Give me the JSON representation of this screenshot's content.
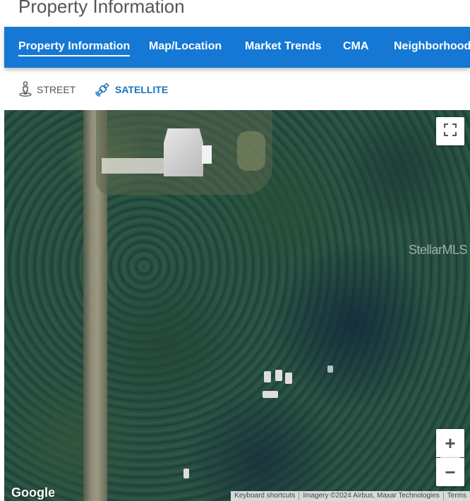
{
  "header": {
    "title": "Property Information"
  },
  "tabs": [
    {
      "label": "Property Information",
      "active": true
    },
    {
      "label": "Map/Location",
      "active": false
    },
    {
      "label": "Market Trends",
      "active": false
    },
    {
      "label": "CMA",
      "active": false
    },
    {
      "label": "Neighborhood",
      "active": false
    }
  ],
  "map_view": {
    "street_label": "STREET",
    "street_icon": "street-view-icon",
    "satellite_label": "SATELLITE",
    "satellite_icon": "satellite-icon",
    "selected": "SATELLITE"
  },
  "map": {
    "watermark": "StellarMLS",
    "logo": "Google",
    "attribution": {
      "shortcuts": "Keyboard shortcuts",
      "imagery": "Imagery ©2024 Airbus, Maxar Technologies",
      "terms": "Terms"
    },
    "controls": {
      "fullscreen_icon": "fullscreen-icon",
      "zoom_in": "+",
      "zoom_out": "−"
    }
  },
  "colors": {
    "tab_bar": "#1478d4",
    "active_toggle": "#1a73b8",
    "inactive_toggle": "#555555"
  }
}
